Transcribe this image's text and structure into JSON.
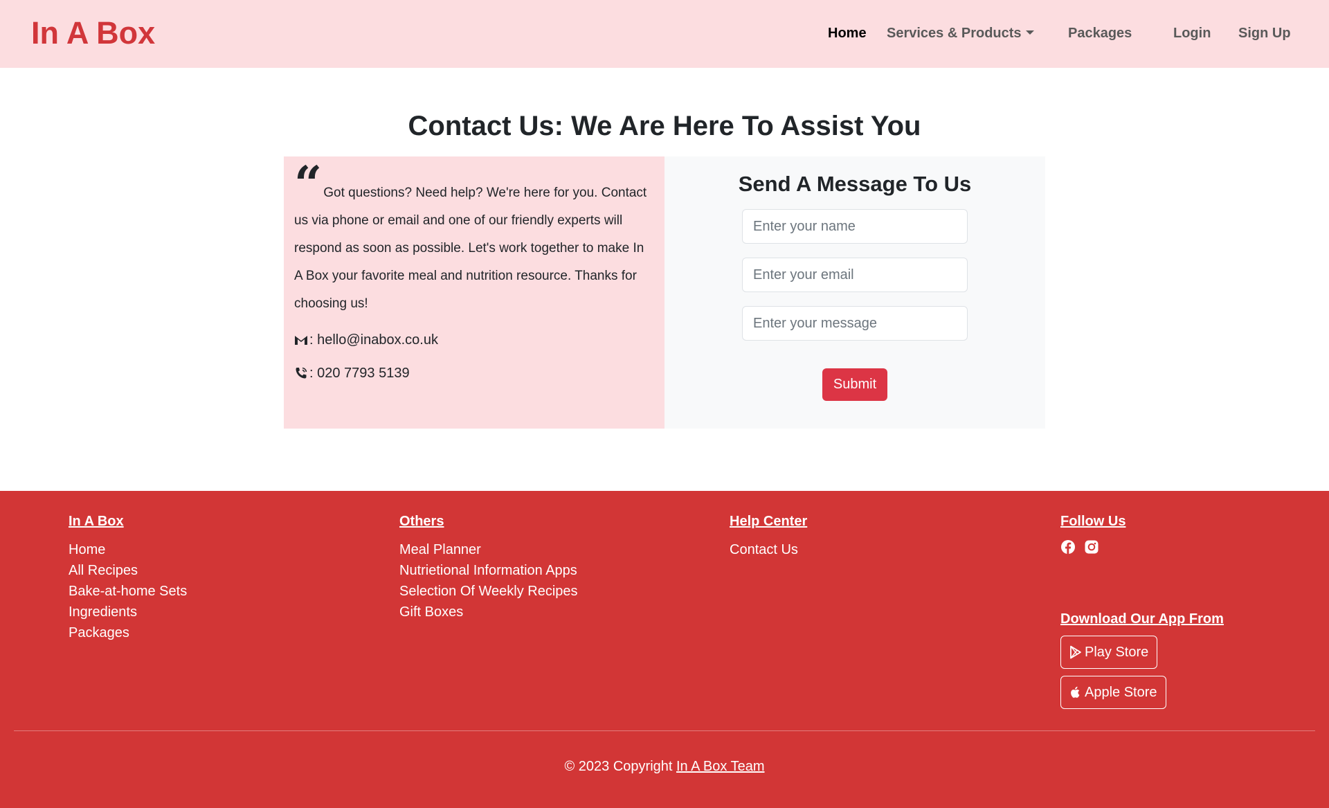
{
  "navbar": {
    "brand": "In A Box",
    "links": {
      "home": "Home",
      "services": "Services & Products",
      "packages": "Packages",
      "login": "Login",
      "signup": "Sign Up"
    }
  },
  "main": {
    "heading": "Contact Us: We Are Here To Assist You",
    "info": {
      "text": "Got questions? Need help? We're here for you. Contact us via phone or email and one of our friendly experts will respond as soon as possible. Let's work together to make In A Box your favorite meal and nutrition resource. Thanks for choosing us!",
      "email_label": ": hello@inabox.co.uk",
      "phone_label": ": 020 7793 5139"
    },
    "form": {
      "title": "Send A Message To Us",
      "name_placeholder": "Enter your name",
      "email_placeholder": "Enter your email",
      "message_placeholder": "Enter your message",
      "submit_label": "Submit"
    }
  },
  "footer": {
    "col1": {
      "heading": "In A Box",
      "links": [
        "Home",
        "All Recipes",
        "Bake-at-home Sets",
        "Ingredients",
        "Packages"
      ]
    },
    "col2": {
      "heading": "Others",
      "links": [
        "Meal Planner",
        "Nutrietional Information Apps",
        "Selection Of Weekly Recipes",
        "Gift Boxes"
      ]
    },
    "col3": {
      "heading": "Help Center",
      "links": [
        "Contact Us"
      ]
    },
    "col4": {
      "heading": "Follow Us",
      "social_icons": [
        "facebook-icon",
        "instagram-icon"
      ],
      "download_heading": "Download Our App From",
      "play_store": "Play Store",
      "apple_store": "Apple Store"
    },
    "copyright_prefix": "© 2023 Copyright ",
    "copyright_link": "In A Box Team"
  },
  "colors": {
    "nav_bg": "#fcdde0",
    "brand_red": "#d1363a",
    "footer_bg": "#d23636",
    "submit_bg": "#dc3545"
  }
}
